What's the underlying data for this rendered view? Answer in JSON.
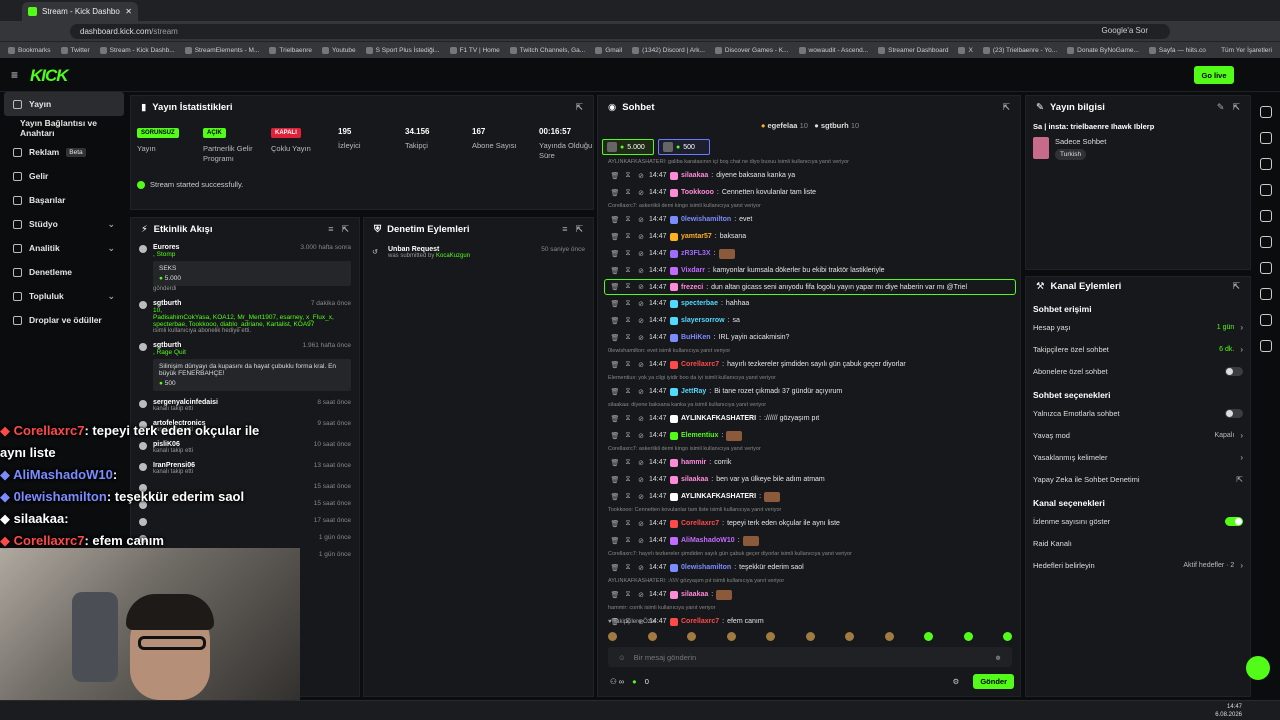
{
  "browser": {
    "tab_title": "Stream - Kick Dashboard",
    "url_host": "dashboard.kick.com",
    "url_path": "/stream",
    "google_label": "Google'a Sor",
    "bookmarks": [
      "Bookmarks",
      "Twitter",
      "Stream - Kick Dashb...",
      "StreamElements - M...",
      "Trielbaenre",
      "Youtube",
      "S Sport Plus İstediği...",
      "F1 TV | Home",
      "Twitch Channels, Ga...",
      "Gmail",
      "(1342) Discord | Ark...",
      "Discover Games - K...",
      "wowaudit - Ascend...",
      "Streamer Dashboard",
      "X",
      "(23) Trielbaenre - Yo...",
      "Donate ByNoGame...",
      "Sayfa — hiits.co"
    ],
    "bookmarks_all": "Tüm Yer İşaretleri"
  },
  "app": {
    "logo": "KICK",
    "go_live": "Go live"
  },
  "sidebar": {
    "items": [
      {
        "label": "Yayın",
        "active": true
      },
      {
        "label": "Yayın Bağlantısı ve Anahtarı",
        "sub": true
      },
      {
        "label": "Reklam",
        "beta": "Beta"
      },
      {
        "label": "Gelir"
      },
      {
        "label": "Başarılar"
      },
      {
        "label": "Stüdyo",
        "chev": "⌄"
      },
      {
        "label": "Analitik",
        "chev": "⌄"
      },
      {
        "label": "Denetleme"
      },
      {
        "label": "Topluluk",
        "chev": "⌄"
      },
      {
        "label": "Droplar ve ödüller"
      }
    ]
  },
  "stats": {
    "title": "Yayın İstatistikleri",
    "badges": [
      {
        "text": "SORUNSUZ",
        "label": "Yayın",
        "color": "#53fc18"
      },
      {
        "text": "AÇIK",
        "label": "Partnerlik Gelir Programı",
        "color": "#53fc18"
      },
      {
        "text": "KAPALI",
        "label": "Çoklu Yayın",
        "color": "#e0213a"
      }
    ],
    "numbers": [
      {
        "value": "195",
        "label": "İzleyici"
      },
      {
        "value": "34.156",
        "label": "Takipçi"
      },
      {
        "value": "167",
        "label": "Abone Sayısı"
      },
      {
        "value": "00:16:57",
        "label": "Yayında Olduğu Süre"
      }
    ],
    "success": "Stream started successfully."
  },
  "events": {
    "title": "Etkinlik Akışı",
    "items": [
      {
        "user": "Eurores",
        "time": "3.000 hafta sonra",
        "line": ", Stomp",
        "box": "SEKS",
        "gift": "5.000",
        "after": "gönderdi"
      },
      {
        "user": "sgtburth",
        "time": "7 dakika önce",
        "line": "10,",
        "names": "PadisahimCokYasa, KOA12, Mr_Mert1907, esarney, x_Flux_x, specterbae, Tookkooo, diablo_adriane, Kartalist, KOA97",
        "after": "isimli kullanıcıya abonelik hediye etti."
      },
      {
        "user": "sgtburth",
        "time": "1.961 hafta önce",
        "line": ", Rage Quit",
        "box": "Silinişim dünyayı da kupasını da hayat çubuklu forma kral. En büyük FENERBAHÇE!",
        "gift": "500"
      },
      {
        "user": "sergenyalcinfedaisi",
        "time": "8 saat önce",
        "after": "kanalı takip etti"
      },
      {
        "user": "artofelectronics",
        "time": "9 saat önce",
        "after": "kanalı takip etti"
      },
      {
        "user": "pisliK06",
        "time": "10 saat önce",
        "after": "kanalı takip etti"
      },
      {
        "user": "IranPrensi06",
        "time": "13 saat önce",
        "after": "kanalı takip etti"
      },
      {
        "user": "",
        "time": "15 saat önce"
      },
      {
        "user": "",
        "time": "15 saat önce"
      },
      {
        "user": "",
        "time": "17 saat önce"
      },
      {
        "user": "",
        "time": "1 gün önce"
      },
      {
        "user": "",
        "time": "1 gün önce"
      }
    ]
  },
  "moderation": {
    "title": "Denetim Eylemleri",
    "items": [
      {
        "title": "Unban Request",
        "sub": "was submitted by",
        "by": "KocaKuzgun",
        "time": "50 saniye önce"
      }
    ]
  },
  "chat": {
    "title": "Sohbet",
    "users": [
      {
        "name": "egefelaa",
        "count": "10"
      },
      {
        "name": "sgtburh",
        "count": "10"
      }
    ],
    "pinned": [
      {
        "value": "5.000"
      },
      {
        "value": "500"
      }
    ],
    "input_placeholder": "Bir mesaj gönderin",
    "points": "0",
    "send": "Gönder",
    "emote_label": "Takipçilere Özel",
    "messages": [
      {
        "reply": "AYLINKAFKASHATERI: galiba karatasının içi boş chat ne diyo buxuu isimli kullanıcıya yanıt veriyor"
      },
      {
        "time": "14:47",
        "user": "silaakaa",
        "color": "#ff8ad8",
        "text": "diyene baksana kanka ya"
      },
      {
        "time": "14:47",
        "user": "Tookkooo",
        "color": "#ff8ad8",
        "text": "Cennetten kovulanlar tam liste"
      },
      {
        "reply": "Corellaxrc7: askeriikli demi kingo isimli kullanıcıya yanıt veriyor"
      },
      {
        "time": "14:47",
        "user": "0lewishamilton",
        "color": "#7b8cff",
        "text": "evet"
      },
      {
        "time": "14:47",
        "user": "yamtar57",
        "color": "#ffb020",
        "text": "baksana"
      },
      {
        "time": "14:47",
        "user": "zR3FL3X",
        "color": "#a06bff",
        "text": ""
      },
      {
        "time": "14:47",
        "user": "Vixdarr",
        "color": "#c46bff",
        "text": "kamyonlar kumsala dökerler bu ekibi traktör lastikleriyle"
      },
      {
        "time": "14:47",
        "user": "frezeci",
        "color": "#ff8ad8",
        "text": "dun altan gicass seni anıyodu fifa logolu yayın yapar mı diye haberin var mı @Triel",
        "highlight": true
      },
      {
        "time": "14:47",
        "user": "specterbae",
        "color": "#52d9ff",
        "text": "hahhaa"
      },
      {
        "time": "14:47",
        "user": "slayersorrow",
        "color": "#52d9ff",
        "text": "sa"
      },
      {
        "time": "14:47",
        "user": "BuHiKen",
        "color": "#7b8cff",
        "text": "IRL yayin acicakmisin?"
      },
      {
        "reply": "0lewishamilton: evet isimli kullanıcıya yanıt veriyor"
      },
      {
        "time": "14:47",
        "user": "Corellaxrc7",
        "color": "#ff4a4a",
        "text": "hayırlı tezkereler şimdiden sayılı gün çabuk geçer diyorlar"
      },
      {
        "reply": "Elementiux: yok ya cilgi iyidir boo da iyi isimli kullanıcıya yanıt veriyor"
      },
      {
        "time": "14:47",
        "user": "JettRay",
        "color": "#52d9ff",
        "text": "Bi tane rozet çıkmadı 37 gündür açıyırum"
      },
      {
        "reply": "silaakaa: diyene baksana kanka ya isimli kullanıcıya yanıt veriyor"
      },
      {
        "time": "14:47",
        "user": "AYLINKAFKASHATERI",
        "color": "#ffffff",
        "text": ":////// gözyaşım pıt"
      },
      {
        "time": "14:47",
        "user": "Elementiux",
        "color": "#53fc18",
        "text": ""
      },
      {
        "reply": "Corellaxrc7: askeriikli demi kingo isimli kullanıcıya yanıt veriyor"
      },
      {
        "time": "14:47",
        "user": "hammir",
        "color": "#ff8ad8",
        "text": "corrik"
      },
      {
        "time": "14:47",
        "user": "silaakaa",
        "color": "#ff8ad8",
        "text": "ben var ya ülkeye bile adım atmam"
      },
      {
        "time": "14:47",
        "user": "AYLINKAFKASHATERI",
        "color": "#ffffff",
        "text": ""
      },
      {
        "reply": "Tookkooo: Cennetten kovulanlar tam liste isimli kullanıcıya yanıt veriyor"
      },
      {
        "time": "14:47",
        "user": "Corellaxrc7",
        "color": "#ff4a4a",
        "text": "tepeyi terk eden okçular ile aynı liste"
      },
      {
        "time": "14:47",
        "user": "AliMashadoW10",
        "color": "#c46bff",
        "text": ""
      },
      {
        "reply": "Corellaxrc7: hayırlı tezkereler şimdiden sayılı gün çabuk geçer diyorlar isimli kullanıcıya yanıt veriyor"
      },
      {
        "time": "14:47",
        "user": "0lewishamilton",
        "color": "#7b8cff",
        "text": "teşekkür ederim saol"
      },
      {
        "reply": "AYLINKAFKASHATERI: :////// gözyaşım pıt isimli kullanıcıya yanıt veriyor"
      },
      {
        "time": "14:47",
        "user": "silaakaa",
        "color": "#ff8ad8",
        "text": ""
      },
      {
        "reply": "hammir: corrik isimli kullanıcıya yanıt veriyor"
      },
      {
        "time": "14:47",
        "user": "Corellaxrc7",
        "color": "#ff4a4a",
        "text": "efem canım"
      }
    ]
  },
  "info": {
    "title": "Yayın bilgisi",
    "stream_title": "Sa | insta: trielbaenre Ihawk Iblerp",
    "category": "Sadece Sohbet",
    "tag": "Turkish"
  },
  "channel": {
    "title": "Kanal Eylemleri",
    "sections": [
      {
        "heading": "Sohbet erişimi",
        "rows": [
          {
            "label": "Hesap yaşı",
            "value": "1 gün",
            "type": "chev"
          },
          {
            "label": "Takipçilere özel sohbet",
            "value": "6 dk.",
            "type": "chev"
          },
          {
            "label": "Abonelere özel sohbet",
            "type": "toggle",
            "on": false
          }
        ]
      },
      {
        "heading": "Sohbet seçenekleri",
        "rows": [
          {
            "label": "Yalnızca Emotlarla sohbet",
            "type": "toggle",
            "on": false
          },
          {
            "label": "Yavaş mod",
            "value": "Kapalı",
            "type": "chev",
            "grey": true
          },
          {
            "label": "Yasaklanmış kelimeler",
            "type": "chev"
          },
          {
            "label": "Yapay Zeka ile Sohbet Denetimi",
            "type": "ext"
          }
        ]
      },
      {
        "heading": "Kanal seçenekleri",
        "rows": [
          {
            "label": "İzlenme sayısını göster",
            "type": "toggle",
            "on": true
          },
          {
            "label": "Raid Kanalı",
            "type": "none"
          },
          {
            "label": "Hedefleri belirleyin",
            "value": "Aktif hedefler · 2",
            "type": "chev",
            "grey": true
          }
        ]
      }
    ]
  },
  "overlay": [
    {
      "user": "Corellaxrc7",
      "color": "#ff4a4a",
      "text": ": tepeyi terk eden okçular ile"
    },
    {
      "user": "",
      "text": "aynı liste"
    },
    {
      "user": "AliMashadoW10",
      "color": "#7b8cff",
      "text": ":"
    },
    {
      "user": "0lewishamilton",
      "color": "#7b8cff",
      "text": ": teşekkür ederim saol"
    },
    {
      "user": "silaakaa",
      "color": "#ffffff",
      "text": ":"
    },
    {
      "user": "Corellaxrc7",
      "color": "#ff4a4a",
      "text": ": efem canım"
    }
  ],
  "taskbar": {
    "time": "14:47",
    "date": "6.08.2026"
  }
}
